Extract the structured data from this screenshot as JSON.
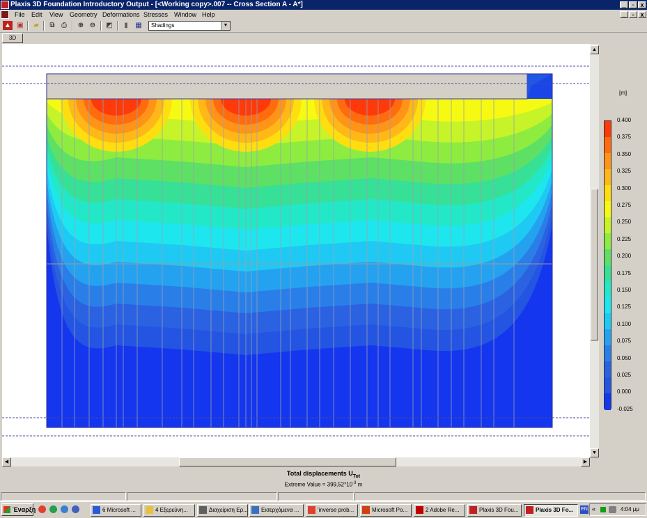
{
  "window": {
    "title": "Plaxis 3D Foundation Introductory Output - [<Working copy>.007  --  Cross Section A - A*]"
  },
  "menu": [
    "File",
    "Edit",
    "View",
    "Geometry",
    "Deformations",
    "Stresses",
    "Window",
    "Help"
  ],
  "toolbar": {
    "icons": [
      "plaxis-icon",
      "stop-icon",
      "open-folder-icon",
      "copy-icon",
      "print-icon",
      "zoom-in-icon",
      "zoom-out-icon",
      "reset-view-icon",
      "structures-icon",
      "table-icon"
    ],
    "view_select": "Shadings"
  },
  "tabs": [
    "3D"
  ],
  "legend": {
    "unit": "[m]",
    "labels": [
      "0.400",
      "0.375",
      "0.350",
      "0.325",
      "0.300",
      "0.275",
      "0.250",
      "0.225",
      "0.200",
      "0.175",
      "0.150",
      "0.125",
      "0.100",
      "0.075",
      "0.050",
      "0.025",
      "0.000",
      "-0.025"
    ],
    "colors": [
      "#ff3a0a",
      "#ff6c10",
      "#ff9418",
      "#ffb818",
      "#ffde10",
      "#f6fa12",
      "#c6f428",
      "#8eec40",
      "#5ee064",
      "#36e096",
      "#22e8c8",
      "#1ee6ee",
      "#1ecaf4",
      "#24a2f0",
      "#2a7ee8",
      "#2a62e2",
      "#2454e2",
      "#1436ee"
    ]
  },
  "plot": {
    "title_main": "Total displacements U",
    "title_sub": "Tot",
    "extreme_prefix": "Extreme Value = 399,52*10",
    "extreme_exp": "-3",
    "extreme_unit": " m"
  },
  "taskbar": {
    "start": "Έναρξη",
    "items": [
      {
        "label": "6 Microsoft ...",
        "icon": "word-icon",
        "color": "#2a5bd7"
      },
      {
        "label": "4 Εξερεύνη...",
        "icon": "folder-icon",
        "color": "#e8c040"
      },
      {
        "label": "Διαχείριση Ερ...",
        "icon": "computer-management-icon",
        "color": "#606060"
      },
      {
        "label": "Εισερχόμενα ...",
        "icon": "mail-icon",
        "color": "#3a70c0"
      },
      {
        "label": "'inverse prob...",
        "icon": "browser-icon",
        "color": "#e04030"
      },
      {
        "label": "Microsoft Po...",
        "icon": "powerpoint-icon",
        "color": "#d04010"
      },
      {
        "label": "2 Adobe Re...",
        "icon": "adobe-reader-icon",
        "color": "#c00000"
      },
      {
        "label": "Plaxis 3D Fou...",
        "icon": "plaxis-icon",
        "color": "#c02020"
      },
      {
        "label": "Plaxis 3D Fo...",
        "icon": "plaxis-icon",
        "color": "#c02020"
      }
    ],
    "lang": "EN",
    "time": "4:04 μμ"
  }
}
